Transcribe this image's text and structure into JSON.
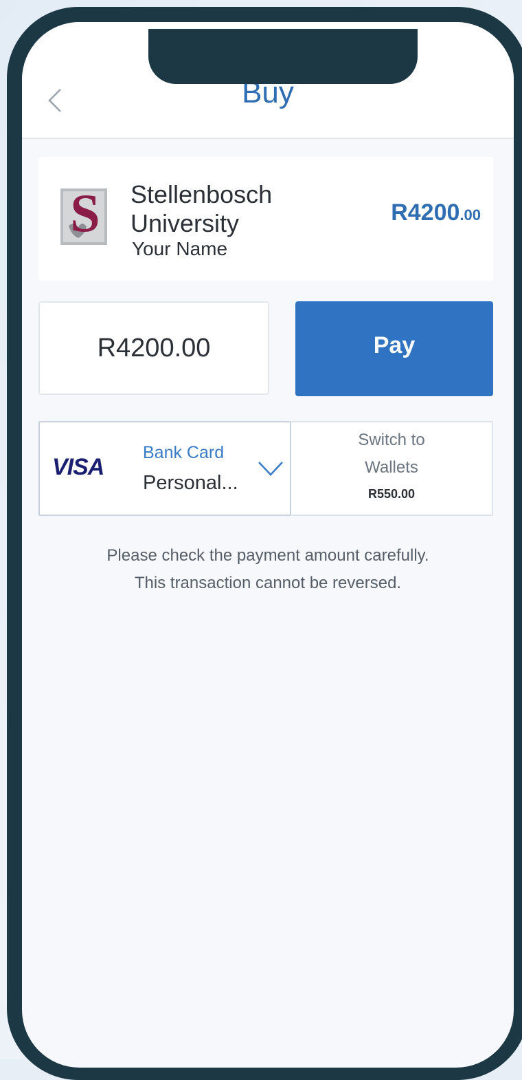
{
  "nav": {
    "title": "Buy"
  },
  "merchant": {
    "name": "Stellenbosch University",
    "subtitle": "Your Name",
    "amount_main": "R4200",
    "amount_cents": ".00",
    "logo_letter": "S"
  },
  "payment": {
    "amount_value": "R4200.00",
    "pay_label": "Pay"
  },
  "method": {
    "brand": "VISA",
    "label": "Bank Card",
    "value": "Personal..."
  },
  "wallets": {
    "line1": "Switch to",
    "line2": "Wallets",
    "balance": "R550.00"
  },
  "notice": {
    "line1": "Please check the payment amount carefully.",
    "line2": "This transaction cannot be reversed."
  },
  "colors": {
    "accent": "#2f73c2",
    "frame": "#1c3845",
    "logo_maroon": "#8a1c48",
    "visa_blue": "#1a1f71"
  },
  "icons": {
    "back": "chevron-left-icon",
    "dropdown": "chevron-down-icon",
    "logo": "stellenbosch-logo"
  }
}
